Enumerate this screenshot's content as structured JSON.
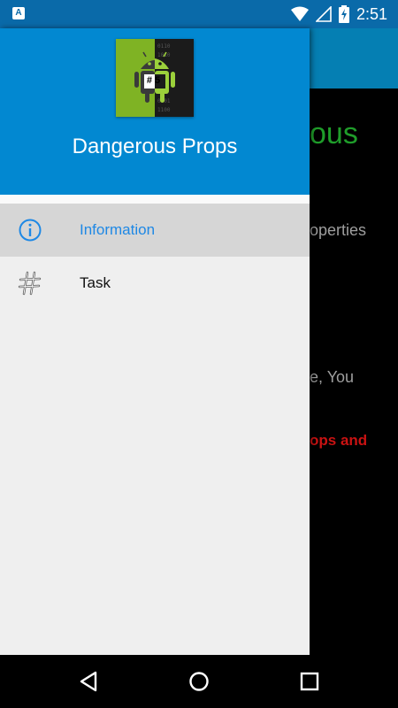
{
  "status_bar": {
    "notification_badge": "A",
    "time": "2:51",
    "battery_level": "charging"
  },
  "background": {
    "title_fragment": "ous",
    "line1_fragment": "operties",
    "line2_fragment": "e, You",
    "line3_fragment": "ops and"
  },
  "drawer": {
    "app_name": "Dangerous Props",
    "logo_badge": "#5",
    "items": [
      {
        "label": "Information",
        "icon": "info-icon",
        "selected": true
      },
      {
        "label": "Task",
        "icon": "hash-icon",
        "selected": false
      }
    ]
  },
  "colors": {
    "header_blue": "#0288d1",
    "selected_text": "#1e88e5",
    "bg_title_green": "#1f9d2a",
    "bg_red": "#c91212"
  }
}
